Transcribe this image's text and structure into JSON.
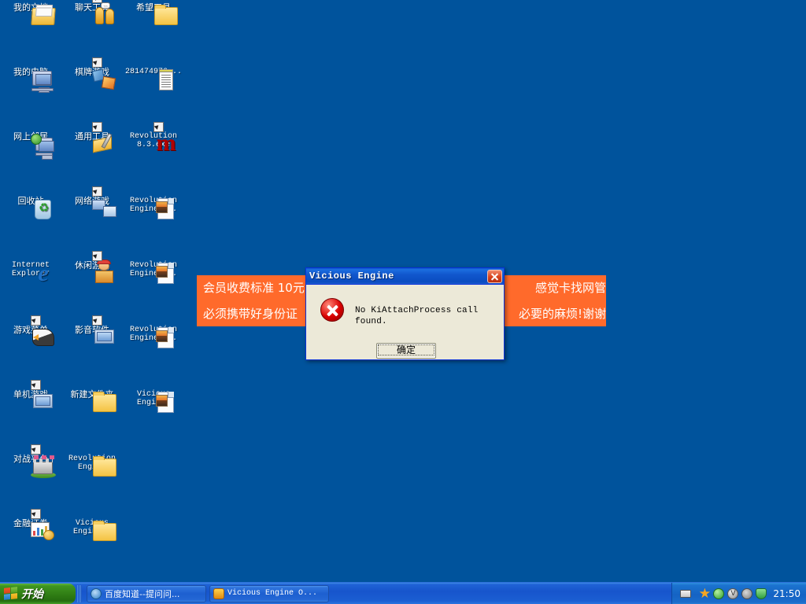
{
  "desktop": {
    "background_color": "#00539c",
    "icons": [
      {
        "label": "我的文档",
        "art": "docs",
        "shortcut": false,
        "mono": false,
        "col": 0,
        "row": 0
      },
      {
        "label": "聊天工具",
        "art": "chat",
        "shortcut": true,
        "mono": false,
        "col": 1,
        "row": 0
      },
      {
        "label": "希望工具",
        "art": "folder",
        "shortcut": false,
        "mono": false,
        "col": 2,
        "row": 0
      },
      {
        "label": "我的电脑",
        "art": "computer",
        "shortcut": false,
        "mono": false,
        "col": 0,
        "row": 1
      },
      {
        "label": "棋牌游戏",
        "art": "dice",
        "shortcut": true,
        "mono": false,
        "col": 1,
        "row": 1
      },
      {
        "label": "281474976...",
        "art": "note",
        "shortcut": false,
        "mono": true,
        "col": 2,
        "row": 1
      },
      {
        "label": "网上邻居",
        "art": "network",
        "shortcut": false,
        "mono": false,
        "col": 0,
        "row": 2
      },
      {
        "label": "通用工具",
        "art": "tool",
        "shortcut": true,
        "mono": false,
        "col": 1,
        "row": 2
      },
      {
        "label": "Revolution\n8.3.exe",
        "art": "mlogo",
        "shortcut": true,
        "mono": true,
        "col": 2,
        "row": 2
      },
      {
        "label": "回收站",
        "art": "bin",
        "shortcut": false,
        "mono": false,
        "col": 0,
        "row": 3
      },
      {
        "label": "网络游戏",
        "art": "netgame",
        "shortcut": true,
        "mono": false,
        "col": 1,
        "row": 3
      },
      {
        "label": "Revolution\nEngine ...",
        "art": "page",
        "shortcut": false,
        "mono": true,
        "col": 2,
        "row": 3
      },
      {
        "label": "Internet\nExplorer",
        "art": "ie",
        "shortcut": false,
        "mono": true,
        "col": 0,
        "row": 4
      },
      {
        "label": "休闲游戏",
        "art": "kid",
        "shortcut": true,
        "mono": false,
        "col": 1,
        "row": 4
      },
      {
        "label": "Revolution\nEngine ...",
        "art": "page",
        "shortcut": false,
        "mono": true,
        "col": 2,
        "row": 4
      },
      {
        "label": "游戏菜单",
        "art": "eagle",
        "shortcut": true,
        "mono": false,
        "col": 0,
        "row": 5
      },
      {
        "label": "影音软件",
        "art": "media",
        "shortcut": true,
        "mono": false,
        "col": 1,
        "row": 5
      },
      {
        "label": "Revolution\nEngine ...",
        "art": "page",
        "shortcut": false,
        "mono": true,
        "col": 2,
        "row": 5
      },
      {
        "label": "单机游戏",
        "art": "media",
        "shortcut": true,
        "mono": false,
        "col": 0,
        "row": 6
      },
      {
        "label": "新建文件夹",
        "art": "folder",
        "shortcut": false,
        "mono": false,
        "col": 1,
        "row": 6
      },
      {
        "label": "Vicious\nEngi...",
        "art": "page",
        "shortcut": false,
        "mono": true,
        "col": 2,
        "row": 6
      },
      {
        "label": "对战平台",
        "art": "castle",
        "shortcut": true,
        "mono": false,
        "col": 0,
        "row": 7
      },
      {
        "label": "Revolution\nEngine",
        "art": "folder",
        "shortcut": false,
        "mono": true,
        "col": 1,
        "row": 7
      },
      {
        "label": "金融证券",
        "art": "finance",
        "shortcut": true,
        "mono": false,
        "col": 0,
        "row": 8
      },
      {
        "label": "Vicious\nEngine 5",
        "art": "folder",
        "shortcut": false,
        "mono": true,
        "col": 1,
        "row": 8
      }
    ]
  },
  "banner": {
    "background_color": "#ff6a2b",
    "text_color": "#ffffff",
    "line1_left": "会员收费标准 10元",
    "line1_right": "感觉卡找网管",
    "line2_left": "必须携带好身份证",
    "line2_right": "必要的麻烦!谢谢"
  },
  "dialog": {
    "title": "Vicious Engine",
    "message": "No KiAttachProcess call found.",
    "ok_label": "确定",
    "close_label": "×",
    "title_color": "#ffffff",
    "body_color": "#ece9d8",
    "error_color": "#d90000"
  },
  "taskbar": {
    "start_label": "开始",
    "buttons": [
      {
        "label": "百度知道--提问问...",
        "icon": "ie-icon",
        "mono": false
      },
      {
        "label": "Vicious Engine O...",
        "icon": "bug-icon",
        "mono": true
      }
    ],
    "tray": {
      "icons": [
        "star-icon",
        "green-shield-icon",
        "volume-icon",
        "network-icon",
        "update-shield-icon"
      ],
      "clock": "21:50"
    }
  }
}
